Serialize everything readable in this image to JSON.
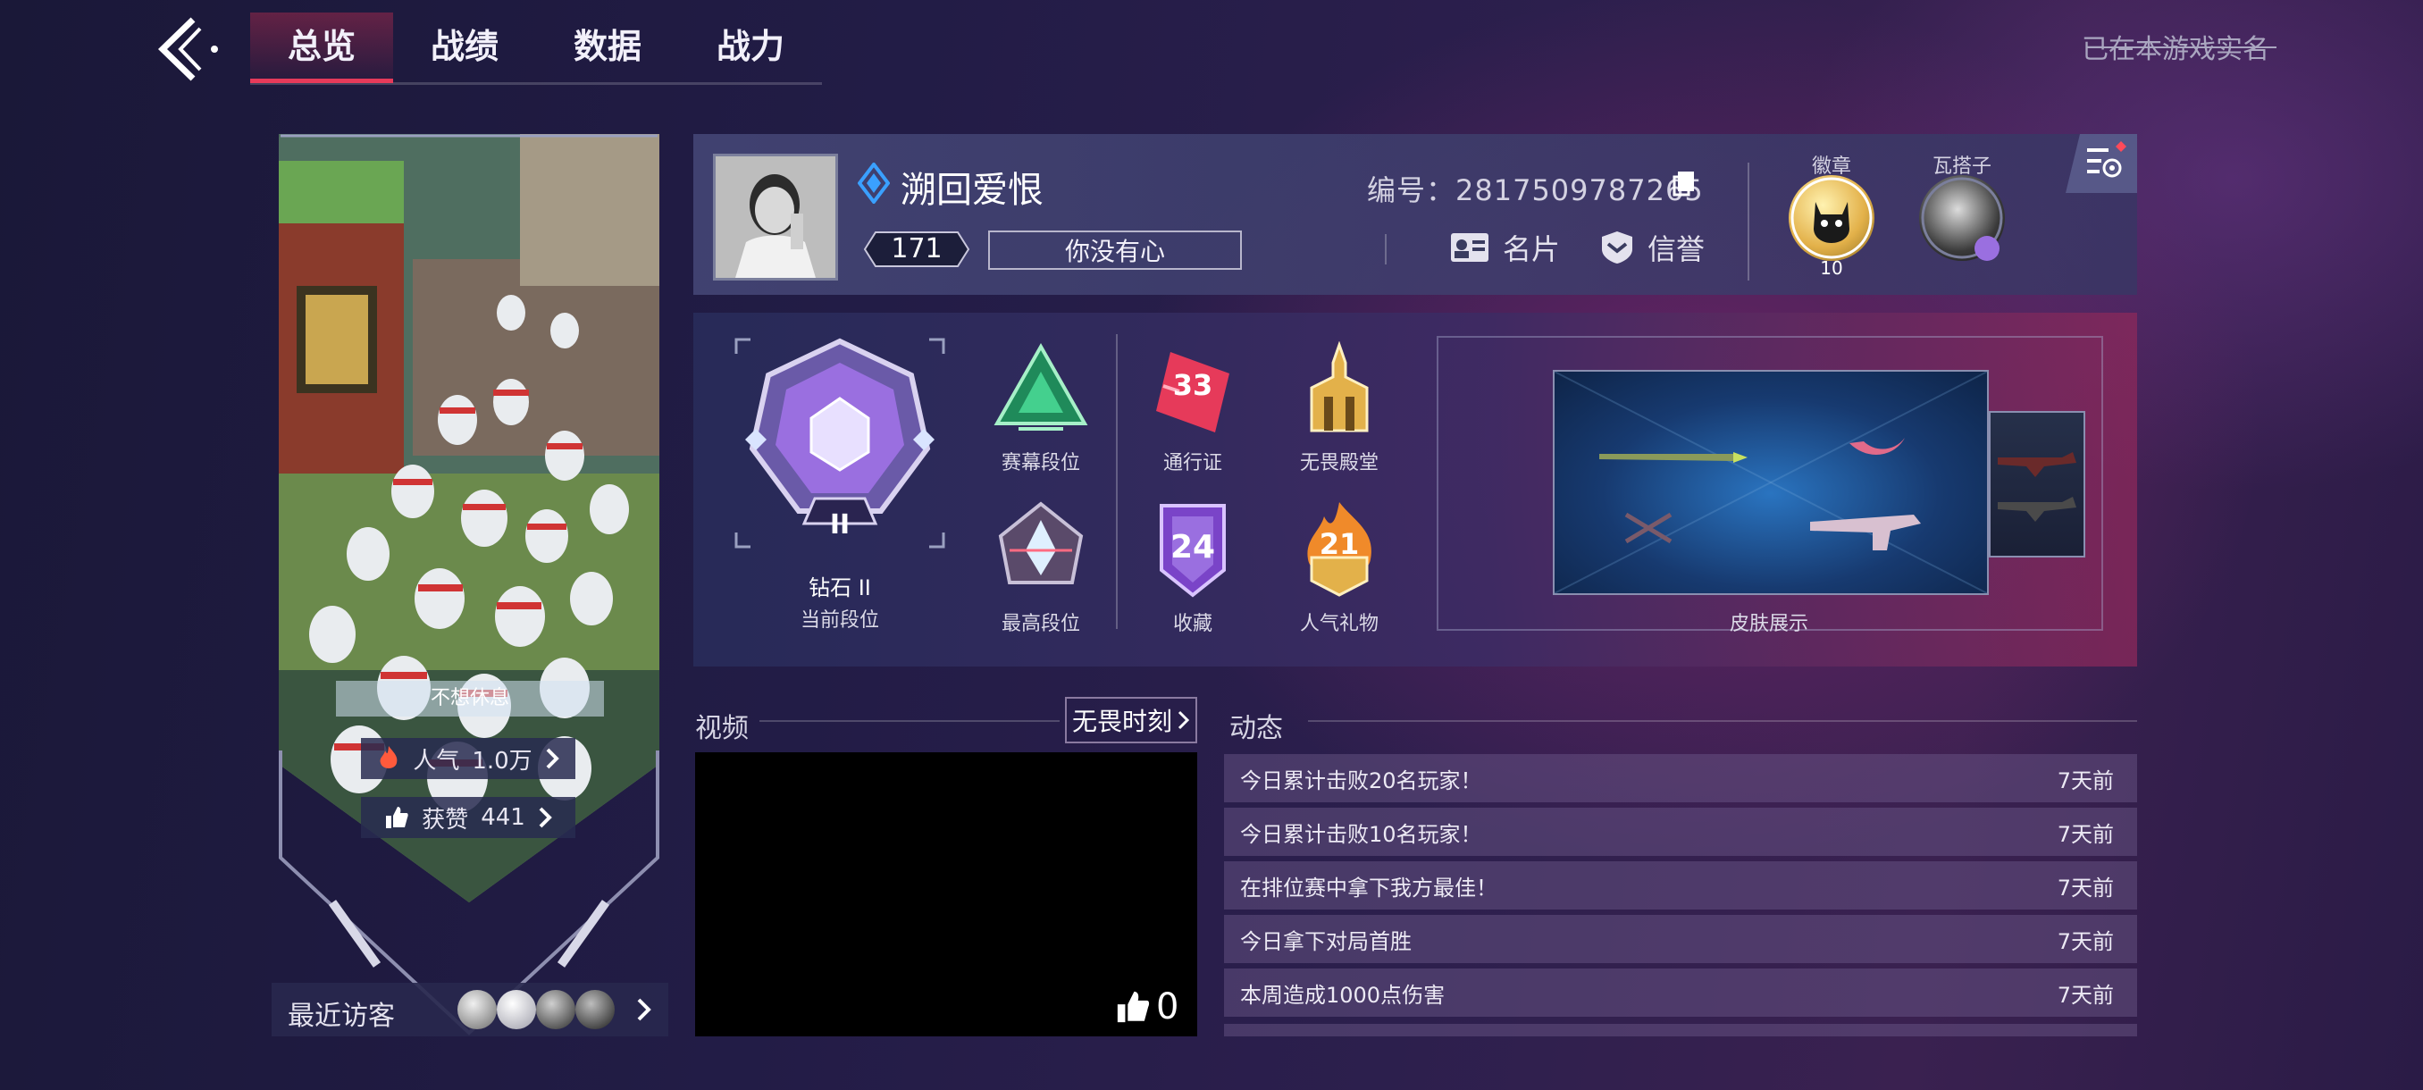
{
  "header": {
    "tabs": [
      "总览",
      "战绩",
      "数据",
      "战力"
    ],
    "active_tab": 0,
    "realname_notice": "已在本游戏实名"
  },
  "left_card": {
    "motto": "不想休息",
    "popularity_label": "人气",
    "popularity_value": "1.0万",
    "likes_label": "获赞",
    "likes_value": "441",
    "recent_visitors_label": "最近访客"
  },
  "profile": {
    "name": "溯回爱恨",
    "level": "171",
    "title": "你没有心",
    "id_label": "编号：2817509787265",
    "card_button": "名片",
    "credit_button": "信誉",
    "badge_label": "徽章",
    "badge_count": "10",
    "valorant_label": "瓦搭子"
  },
  "rank": {
    "tier_numeral": "II",
    "rank_name": "钻石 II",
    "rank_caption": "当前段位",
    "items": [
      {
        "label": "赛幕段位"
      },
      {
        "label": "最高段位"
      },
      {
        "label": "通行证",
        "number": "33"
      },
      {
        "label": "收藏",
        "number": "24"
      },
      {
        "label": "无畏殿堂"
      },
      {
        "label": "人气礼物",
        "number": "21"
      }
    ],
    "skin_showcase_label": "皮肤展示"
  },
  "video": {
    "section_title": "视频",
    "highlight_button": "无畏时刻",
    "like_count": "0"
  },
  "feed": {
    "section_title": "动态",
    "items": [
      {
        "text": "今日累计击败20名玩家！",
        "time": "7天前"
      },
      {
        "text": "今日累计击败10名玩家！",
        "time": "7天前"
      },
      {
        "text": "在排位赛中拿下我方最佳！",
        "time": "7天前"
      },
      {
        "text": "今日拿下对局首胜",
        "time": "7天前"
      },
      {
        "text": "本周造成1000点伤害",
        "time": "7天前"
      }
    ]
  },
  "colors": {
    "accent_red": "#e63a5a",
    "gold": "#e3b14a",
    "diamond_purple": "#9a6fe0"
  }
}
